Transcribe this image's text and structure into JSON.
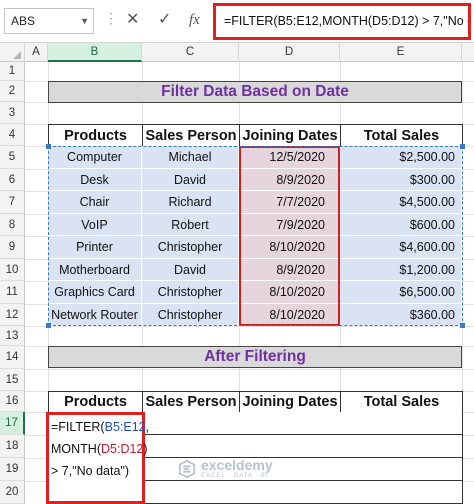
{
  "formula_bar": {
    "name_box": "ABS",
    "cancel_icon": "✕",
    "enter_icon": "✓",
    "fx_label": "fx",
    "formula": "=FILTER(B5:E12,MONTH(D5:D12) > 7,\"No data\")"
  },
  "columns": [
    "A",
    "B",
    "C",
    "D",
    "E"
  ],
  "rows": [
    "1",
    "2",
    "3",
    "4",
    "5",
    "6",
    "7",
    "8",
    "9",
    "10",
    "11",
    "12",
    "13",
    "14",
    "15",
    "16",
    "17",
    "18",
    "19",
    "20"
  ],
  "title": "Filter Data Based on Date",
  "subtitle": "After Filtering",
  "table": {
    "headers": [
      "Products",
      "Sales Person",
      "Joining Dates",
      "Total Sales"
    ],
    "rows": [
      [
        "Computer",
        "Michael",
        "12/5/2020",
        "$2,500.00"
      ],
      [
        "Desk",
        "David",
        "8/9/2020",
        "$300.00"
      ],
      [
        "Chair",
        "Richard",
        "7/7/2020",
        "$4,500.00"
      ],
      [
        "VoIP",
        "Robert",
        "7/9/2020",
        "$600.00"
      ],
      [
        "Printer",
        "Christopher",
        "8/10/2020",
        "$4,600.00"
      ],
      [
        "Motherboard",
        "David",
        "8/9/2020",
        "$1,200.00"
      ],
      [
        "Graphics Card",
        "Christopher",
        "8/10/2020",
        "$6,500.00"
      ],
      [
        "Network Router",
        "Christopher",
        "8/10/2020",
        "$360.00"
      ]
    ]
  },
  "output_table": {
    "headers": [
      "Products",
      "Sales Person",
      "Joining Dates",
      "Total Sales"
    ]
  },
  "editing_cell": {
    "part1": "=FILTER(",
    "ref1": "B5:E12",
    "part2": ", MONTH(",
    "ref2": "D5:D12",
    "part3": ") > 7,\"No data\")"
  },
  "watermark": {
    "title": "exceldemy",
    "subtitle": "EXCEL · DATA · BI"
  },
  "colors": {
    "accent_red": "#e0201f",
    "title_purple": "#7030a0",
    "table_blue": "#dae3f3",
    "date_pink": "#e6d5dc"
  }
}
